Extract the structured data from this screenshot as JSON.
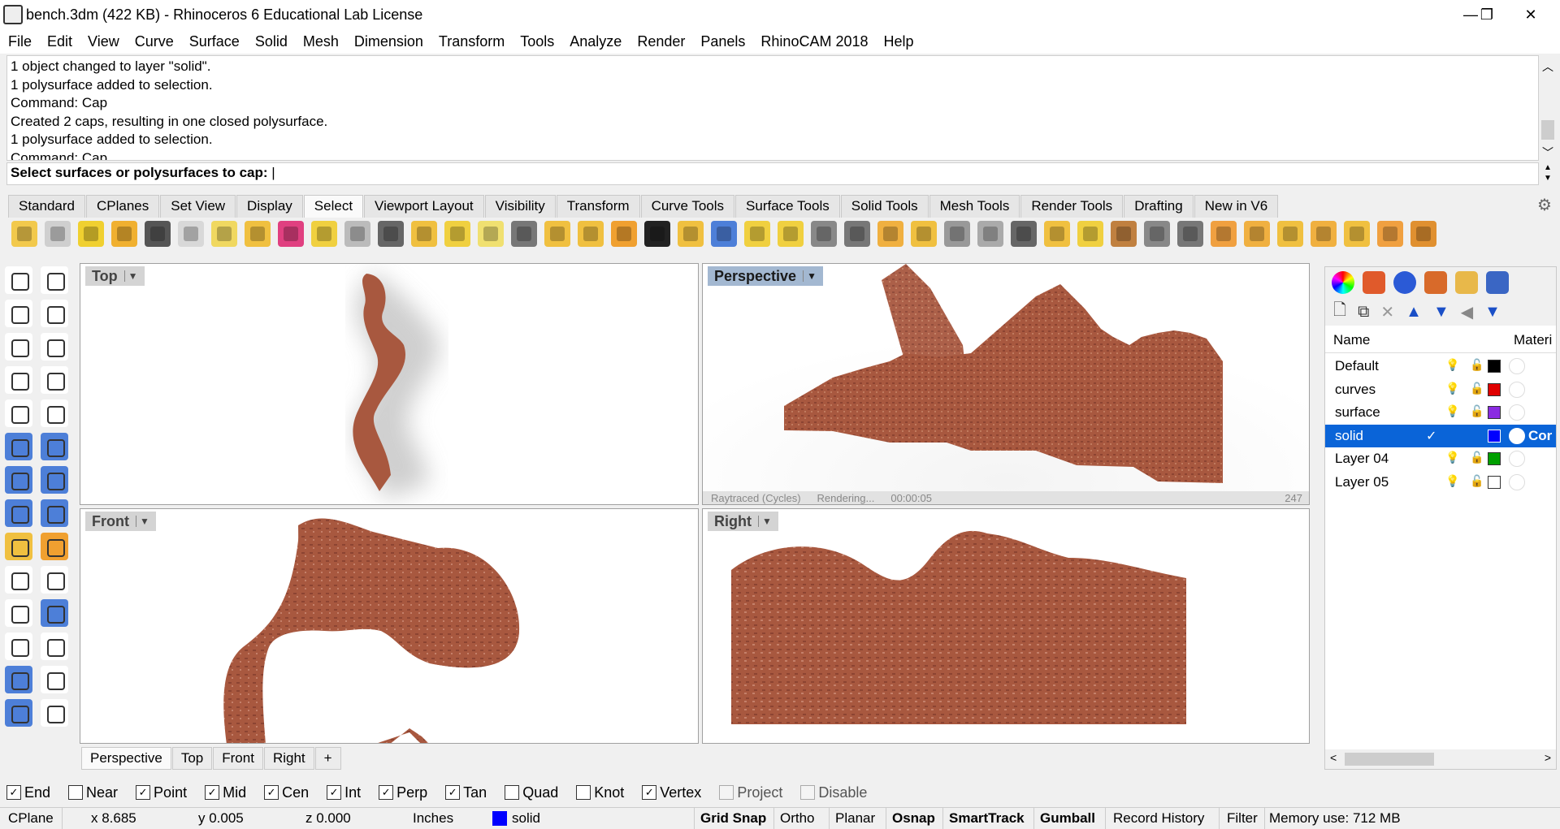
{
  "window": {
    "title": "bench.3dm (422 KB) - Rhinoceros 6 Educational Lab License",
    "minimize": "—",
    "maximize": "❐",
    "close": "✕"
  },
  "menu": [
    "File",
    "Edit",
    "View",
    "Curve",
    "Surface",
    "Solid",
    "Mesh",
    "Dimension",
    "Transform",
    "Tools",
    "Analyze",
    "Render",
    "Panels",
    "RhinoCAM 2018",
    "Help"
  ],
  "command_history": [
    "1 object changed to layer \"solid\".",
    "1 polysurface added to selection.",
    "Command: Cap",
    "Created 2 caps, resulting in one closed polysurface.",
    "1 polysurface added to selection.",
    "Command: Cap"
  ],
  "prompt": "Select surfaces or polysurfaces to cap:",
  "toolbar_tabs": [
    "Standard",
    "CPlanes",
    "Set View",
    "Display",
    "Select",
    "Viewport Layout",
    "Visibility",
    "Transform",
    "Curve Tools",
    "Surface Tools",
    "Solid Tools",
    "Mesh Tools",
    "Render Tools",
    "Drafting",
    "New in V6"
  ],
  "toolbar_tab_active": "Select",
  "viewports": {
    "top": "Top",
    "perspective": "Perspective",
    "front": "Front",
    "right": "Right",
    "render_status": {
      "mode": "Raytraced (Cycles)",
      "state": "Rendering...",
      "time": "00:00:05",
      "passes": "247"
    }
  },
  "viewport_tabs": [
    "Perspective",
    "Top",
    "Front",
    "Right"
  ],
  "viewport_tab_add": "+",
  "layers": {
    "col_name": "Name",
    "col_material": "Materi",
    "rows": [
      {
        "name": "Default",
        "color": "#000000"
      },
      {
        "name": "curves",
        "color": "#e00000"
      },
      {
        "name": "surface",
        "color": "#8a2be2"
      },
      {
        "name": "solid",
        "color": "#0000ff",
        "current": true,
        "material": "Cor"
      },
      {
        "name": "Layer 04",
        "color": "#00a000"
      },
      {
        "name": "Layer 05",
        "color": "#ffffff"
      }
    ]
  },
  "osnaps": [
    {
      "label": "End",
      "checked": true
    },
    {
      "label": "Near",
      "checked": false
    },
    {
      "label": "Point",
      "checked": true
    },
    {
      "label": "Mid",
      "checked": true
    },
    {
      "label": "Cen",
      "checked": true
    },
    {
      "label": "Int",
      "checked": true
    },
    {
      "label": "Perp",
      "checked": true
    },
    {
      "label": "Tan",
      "checked": true
    },
    {
      "label": "Quad",
      "checked": false
    },
    {
      "label": "Knot",
      "checked": false
    },
    {
      "label": "Vertex",
      "checked": true
    },
    {
      "label": "Project",
      "checked": false,
      "disabled": true
    },
    {
      "label": "Disable",
      "checked": false,
      "disabled": true
    }
  ],
  "status": {
    "cplane": "CPlane",
    "x": "x 8.685",
    "y": "y 0.005",
    "z": "z 0.000",
    "units": "Inches",
    "layer": "solid",
    "grid_snap": "Grid Snap",
    "ortho": "Ortho",
    "planar": "Planar",
    "osnap": "Osnap",
    "smarttrack": "SmartTrack",
    "gumball": "Gumball",
    "record_history": "Record History",
    "filter": "Filter",
    "memory": "Memory use: 712 MB"
  },
  "colors": {
    "rust": "#a8583f",
    "selection": "#0a64d8",
    "active_viewport": "#a3b8d1"
  }
}
